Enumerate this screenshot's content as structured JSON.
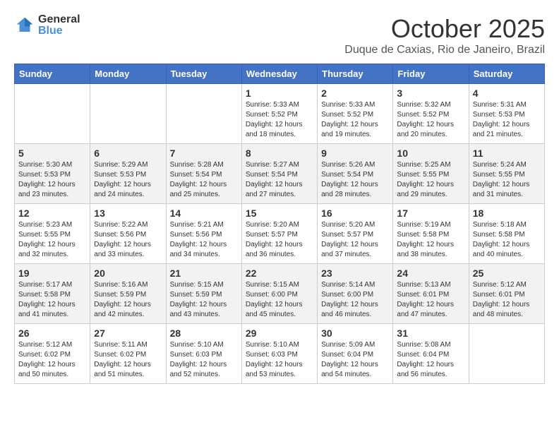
{
  "header": {
    "logo_general": "General",
    "logo_blue": "Blue",
    "month": "October 2025",
    "location": "Duque de Caxias, Rio de Janeiro, Brazil"
  },
  "days_of_week": [
    "Sunday",
    "Monday",
    "Tuesday",
    "Wednesday",
    "Thursday",
    "Friday",
    "Saturday"
  ],
  "weeks": [
    [
      {
        "day": "",
        "sunrise": "",
        "sunset": "",
        "daylight": ""
      },
      {
        "day": "",
        "sunrise": "",
        "sunset": "",
        "daylight": ""
      },
      {
        "day": "",
        "sunrise": "",
        "sunset": "",
        "daylight": ""
      },
      {
        "day": "1",
        "sunrise": "Sunrise: 5:33 AM",
        "sunset": "Sunset: 5:52 PM",
        "daylight": "Daylight: 12 hours and 18 minutes."
      },
      {
        "day": "2",
        "sunrise": "Sunrise: 5:33 AM",
        "sunset": "Sunset: 5:52 PM",
        "daylight": "Daylight: 12 hours and 19 minutes."
      },
      {
        "day": "3",
        "sunrise": "Sunrise: 5:32 AM",
        "sunset": "Sunset: 5:52 PM",
        "daylight": "Daylight: 12 hours and 20 minutes."
      },
      {
        "day": "4",
        "sunrise": "Sunrise: 5:31 AM",
        "sunset": "Sunset: 5:53 PM",
        "daylight": "Daylight: 12 hours and 21 minutes."
      }
    ],
    [
      {
        "day": "5",
        "sunrise": "Sunrise: 5:30 AM",
        "sunset": "Sunset: 5:53 PM",
        "daylight": "Daylight: 12 hours and 23 minutes."
      },
      {
        "day": "6",
        "sunrise": "Sunrise: 5:29 AM",
        "sunset": "Sunset: 5:53 PM",
        "daylight": "Daylight: 12 hours and 24 minutes."
      },
      {
        "day": "7",
        "sunrise": "Sunrise: 5:28 AM",
        "sunset": "Sunset: 5:54 PM",
        "daylight": "Daylight: 12 hours and 25 minutes."
      },
      {
        "day": "8",
        "sunrise": "Sunrise: 5:27 AM",
        "sunset": "Sunset: 5:54 PM",
        "daylight": "Daylight: 12 hours and 27 minutes."
      },
      {
        "day": "9",
        "sunrise": "Sunrise: 5:26 AM",
        "sunset": "Sunset: 5:54 PM",
        "daylight": "Daylight: 12 hours and 28 minutes."
      },
      {
        "day": "10",
        "sunrise": "Sunrise: 5:25 AM",
        "sunset": "Sunset: 5:55 PM",
        "daylight": "Daylight: 12 hours and 29 minutes."
      },
      {
        "day": "11",
        "sunrise": "Sunrise: 5:24 AM",
        "sunset": "Sunset: 5:55 PM",
        "daylight": "Daylight: 12 hours and 31 minutes."
      }
    ],
    [
      {
        "day": "12",
        "sunrise": "Sunrise: 5:23 AM",
        "sunset": "Sunset: 5:55 PM",
        "daylight": "Daylight: 12 hours and 32 minutes."
      },
      {
        "day": "13",
        "sunrise": "Sunrise: 5:22 AM",
        "sunset": "Sunset: 5:56 PM",
        "daylight": "Daylight: 12 hours and 33 minutes."
      },
      {
        "day": "14",
        "sunrise": "Sunrise: 5:21 AM",
        "sunset": "Sunset: 5:56 PM",
        "daylight": "Daylight: 12 hours and 34 minutes."
      },
      {
        "day": "15",
        "sunrise": "Sunrise: 5:20 AM",
        "sunset": "Sunset: 5:57 PM",
        "daylight": "Daylight: 12 hours and 36 minutes."
      },
      {
        "day": "16",
        "sunrise": "Sunrise: 5:20 AM",
        "sunset": "Sunset: 5:57 PM",
        "daylight": "Daylight: 12 hours and 37 minutes."
      },
      {
        "day": "17",
        "sunrise": "Sunrise: 5:19 AM",
        "sunset": "Sunset: 5:58 PM",
        "daylight": "Daylight: 12 hours and 38 minutes."
      },
      {
        "day": "18",
        "sunrise": "Sunrise: 5:18 AM",
        "sunset": "Sunset: 5:58 PM",
        "daylight": "Daylight: 12 hours and 40 minutes."
      }
    ],
    [
      {
        "day": "19",
        "sunrise": "Sunrise: 5:17 AM",
        "sunset": "Sunset: 5:58 PM",
        "daylight": "Daylight: 12 hours and 41 minutes."
      },
      {
        "day": "20",
        "sunrise": "Sunrise: 5:16 AM",
        "sunset": "Sunset: 5:59 PM",
        "daylight": "Daylight: 12 hours and 42 minutes."
      },
      {
        "day": "21",
        "sunrise": "Sunrise: 5:15 AM",
        "sunset": "Sunset: 5:59 PM",
        "daylight": "Daylight: 12 hours and 43 minutes."
      },
      {
        "day": "22",
        "sunrise": "Sunrise: 5:15 AM",
        "sunset": "Sunset: 6:00 PM",
        "daylight": "Daylight: 12 hours and 45 minutes."
      },
      {
        "day": "23",
        "sunrise": "Sunrise: 5:14 AM",
        "sunset": "Sunset: 6:00 PM",
        "daylight": "Daylight: 12 hours and 46 minutes."
      },
      {
        "day": "24",
        "sunrise": "Sunrise: 5:13 AM",
        "sunset": "Sunset: 6:01 PM",
        "daylight": "Daylight: 12 hours and 47 minutes."
      },
      {
        "day": "25",
        "sunrise": "Sunrise: 5:12 AM",
        "sunset": "Sunset: 6:01 PM",
        "daylight": "Daylight: 12 hours and 48 minutes."
      }
    ],
    [
      {
        "day": "26",
        "sunrise": "Sunrise: 5:12 AM",
        "sunset": "Sunset: 6:02 PM",
        "daylight": "Daylight: 12 hours and 50 minutes."
      },
      {
        "day": "27",
        "sunrise": "Sunrise: 5:11 AM",
        "sunset": "Sunset: 6:02 PM",
        "daylight": "Daylight: 12 hours and 51 minutes."
      },
      {
        "day": "28",
        "sunrise": "Sunrise: 5:10 AM",
        "sunset": "Sunset: 6:03 PM",
        "daylight": "Daylight: 12 hours and 52 minutes."
      },
      {
        "day": "29",
        "sunrise": "Sunrise: 5:10 AM",
        "sunset": "Sunset: 6:03 PM",
        "daylight": "Daylight: 12 hours and 53 minutes."
      },
      {
        "day": "30",
        "sunrise": "Sunrise: 5:09 AM",
        "sunset": "Sunset: 6:04 PM",
        "daylight": "Daylight: 12 hours and 54 minutes."
      },
      {
        "day": "31",
        "sunrise": "Sunrise: 5:08 AM",
        "sunset": "Sunset: 6:04 PM",
        "daylight": "Daylight: 12 hours and 56 minutes."
      },
      {
        "day": "",
        "sunrise": "",
        "sunset": "",
        "daylight": ""
      }
    ]
  ]
}
